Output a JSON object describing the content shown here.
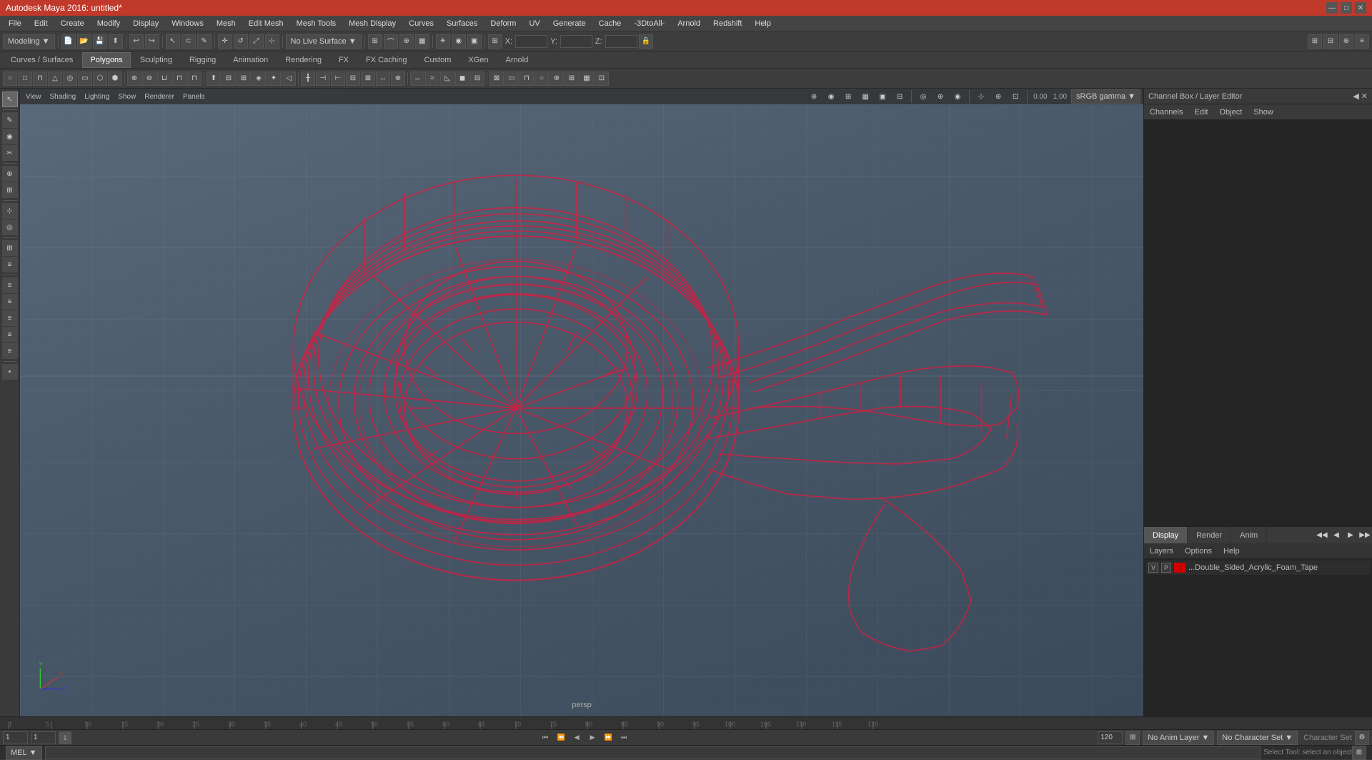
{
  "app": {
    "title": "Autodesk Maya 2016: untitled*",
    "workspace": "Modeling"
  },
  "title_bar": {
    "title": "Autodesk Maya 2016: untitled*",
    "minimize": "—",
    "maximize": "□",
    "close": "✕"
  },
  "menu_bar": {
    "items": [
      "File",
      "Edit",
      "Create",
      "Modify",
      "Display",
      "Windows",
      "Mesh",
      "Edit Mesh",
      "Mesh Tools",
      "Mesh Display",
      "Curves",
      "Surfaces",
      "Deform",
      "UV",
      "Generate",
      "Cache",
      "-3DtoAll-",
      "Arnold",
      "Redshift",
      "Help"
    ]
  },
  "toolbar1": {
    "workspace_label": "Modeling",
    "no_live_surface": "No Live Surface",
    "custom": "Custom",
    "x_label": "X:",
    "y_label": "Y:",
    "z_label": "Z:"
  },
  "tabs": {
    "items": [
      "Curves / Surfaces",
      "Polygons",
      "Sculpting",
      "Rigging",
      "Animation",
      "Rendering",
      "FX",
      "FX Caching",
      "Custom",
      "XGen",
      "Arnold"
    ],
    "active": "Polygons"
  },
  "viewport": {
    "menu_items": [
      "View",
      "Shading",
      "Lighting",
      "Show",
      "Renderer",
      "Panels"
    ],
    "label": "persp",
    "color_mode": "sRGB gamma",
    "value1": "0.00",
    "value2": "1.00"
  },
  "channel_box": {
    "title": "Channel Box / Layer Editor",
    "tabs": [
      "Channels",
      "Edit",
      "Object",
      "Show"
    ]
  },
  "right_bottom": {
    "tabs": [
      "Display",
      "Render",
      "Anim"
    ],
    "active": "Display",
    "sub_tabs": [
      "Layers",
      "Options",
      "Help"
    ]
  },
  "layer": {
    "v_label": "V",
    "p_label": "P",
    "name": "...Double_Sided_Acrylic_Foam_Tape"
  },
  "bottom": {
    "frame_start": "1",
    "frame_current": "1",
    "frame_end": "120",
    "mel_label": "MEL",
    "status_text": "Select Tool: select an object",
    "no_anim_layer": "No Anim Layer",
    "no_char_set": "No Character Set",
    "char_set_label": "Character Set"
  },
  "axes": {
    "x": "X",
    "y": "Y",
    "z": "Z"
  },
  "timeline": {
    "ticks": [
      "1",
      "",
      "5",
      "",
      "",
      "10",
      "",
      "",
      "15",
      "",
      "",
      "20",
      "",
      "",
      "25",
      "",
      "",
      "30",
      "",
      "",
      "35",
      "",
      "",
      "40",
      "",
      "",
      "45",
      "",
      "",
      "50",
      "",
      "",
      "55",
      "",
      "",
      "60",
      "",
      "",
      "65",
      "",
      "",
      "70",
      "",
      "",
      "75",
      "",
      "",
      "80",
      "",
      "",
      "85",
      "",
      "",
      "90",
      "",
      "",
      "95",
      "",
      "",
      "100",
      "",
      "",
      "105",
      "",
      "",
      "110",
      "",
      "",
      "115",
      "",
      "",
      "120"
    ]
  },
  "icons": {
    "select": "↖",
    "move": "✛",
    "rotate": "↺",
    "scale": "⤢",
    "paint": "✎",
    "snap": "⊹",
    "gear": "⚙",
    "layers": "≡",
    "chevron_down": "▼",
    "chevron_right": "▶",
    "skip_back": "⏮",
    "step_back": "⏪",
    "play_back": "◀",
    "play": "▶",
    "step_fwd": "⏩",
    "skip_fwd": "⏭",
    "loop": "↻"
  }
}
